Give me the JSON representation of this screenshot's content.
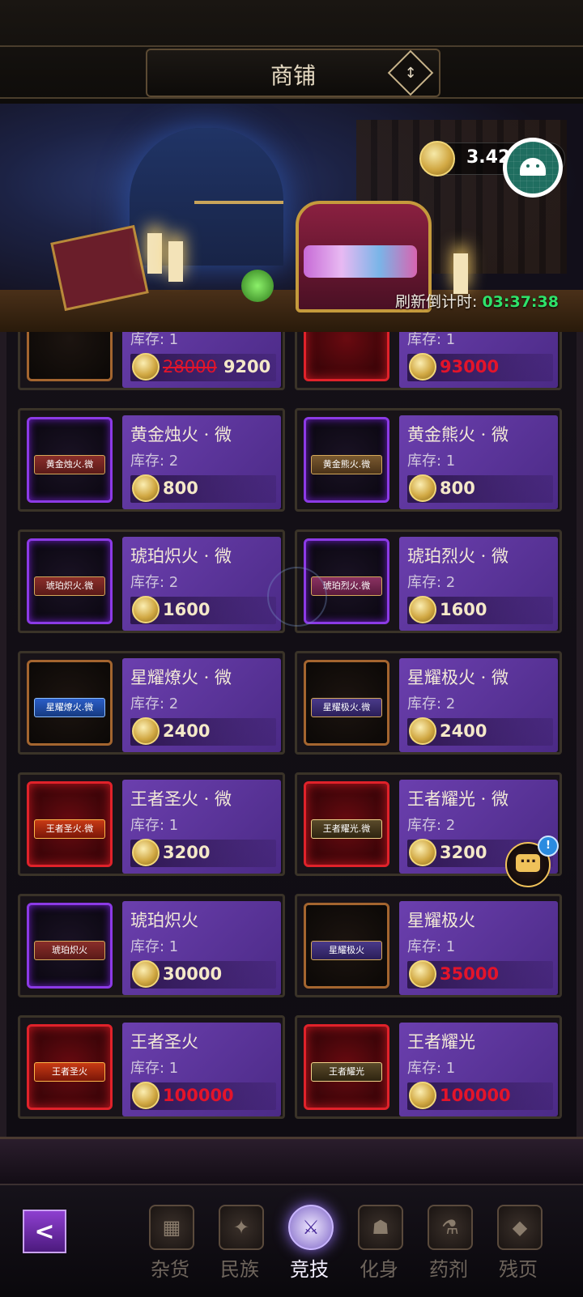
{
  "header": {
    "title": "商铺",
    "toggle_icon": "↕"
  },
  "banner": {
    "currency": {
      "value": "3.42",
      "icon": "gold-coin-icon"
    },
    "refresh": {
      "label": "刷新倒计时:",
      "time": "03:37:38"
    }
  },
  "colors": {
    "accent_purple": "#6b3fae",
    "price_red": "#e3142a",
    "timer_green": "#2ee36a"
  },
  "partial_row": [
    {
      "stock": "库存: 1",
      "old_price": "28000",
      "price": "9200"
    },
    {
      "stock": "库存: 1",
      "price": "93000"
    }
  ],
  "items": [
    {
      "name": "黄金烛火 · 微",
      "tag": "黄金烛火.微",
      "stock": "库存: 2",
      "price": "800"
    },
    {
      "name": "黄金熊火 · 微",
      "tag": "黄金熊火.微",
      "stock": "库存: 1",
      "price": "800"
    },
    {
      "name": "琥珀炽火 · 微",
      "tag": "琥珀炽火.微",
      "stock": "库存: 2",
      "price": "1600"
    },
    {
      "name": "琥珀烈火 · 微",
      "tag": "琥珀烈火.微",
      "stock": "库存: 2",
      "price": "1600"
    },
    {
      "name": "星耀燎火 · 微",
      "tag": "星耀燎火.微",
      "stock": "库存: 2",
      "price": "2400"
    },
    {
      "name": "星耀极火 · 微",
      "tag": "星耀极火.微",
      "stock": "库存: 2",
      "price": "2400"
    },
    {
      "name": "王者圣火 · 微",
      "tag": "王者圣火.微",
      "stock": "库存: 1",
      "price": "3200"
    },
    {
      "name": "王者耀光 · 微",
      "tag": "王者耀光.微",
      "stock": "库存: 2",
      "price": "3200"
    },
    {
      "name": "琥珀炽火",
      "tag": "琥珀炽火",
      "stock": "库存: 1",
      "price": "30000"
    },
    {
      "name": "星耀极火",
      "tag": "星耀极火",
      "stock": "库存: 1",
      "price": "35000"
    },
    {
      "name": "王者圣火",
      "tag": "王者圣火",
      "stock": "库存: 1",
      "price": "100000"
    },
    {
      "name": "王者耀光",
      "tag": "王者耀光",
      "stock": "库存: 1",
      "price": "100000"
    }
  ],
  "chat": {
    "badge": "!"
  },
  "nav": {
    "back_icon": "back-arrow-icon",
    "items": [
      {
        "label": "杂货",
        "icon": "cards-icon"
      },
      {
        "label": "民族",
        "icon": "emblem-icon"
      },
      {
        "label": "竞技",
        "icon": "arena-icon"
      },
      {
        "label": "化身",
        "icon": "avatar-icon"
      },
      {
        "label": "药剂",
        "icon": "potion-icon"
      },
      {
        "label": "残页",
        "icon": "page-icon"
      }
    ]
  }
}
